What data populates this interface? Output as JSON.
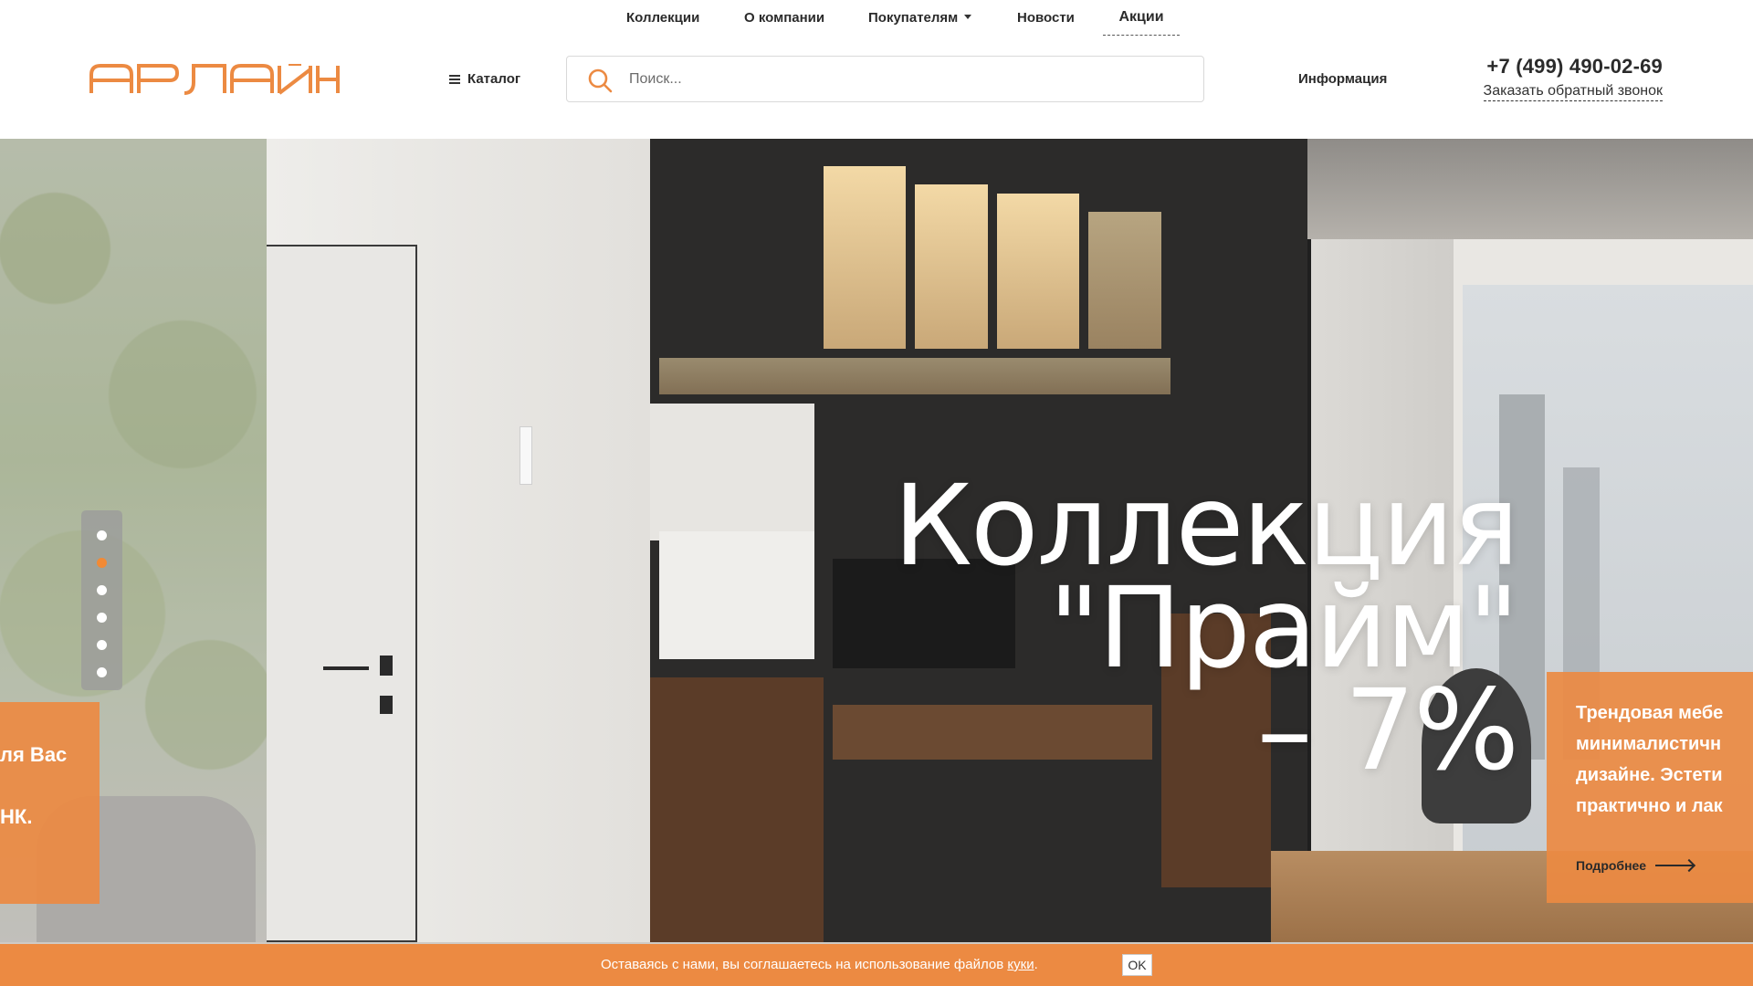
{
  "header": {
    "logo_text": "АРЛАЙН",
    "top_nav": [
      {
        "label": "Коллекции"
      },
      {
        "label": "О компании"
      },
      {
        "label": "Покупателям",
        "has_dropdown": true
      },
      {
        "label": "Новости"
      },
      {
        "label": "Акции",
        "active": true
      }
    ],
    "catalog_label": "Каталог",
    "search_placeholder": "Поиск...",
    "info_label": "Информация",
    "phone": "+7 (499) 490-02-69",
    "callback_label": "Заказать обратный звонок",
    "accent_color": "#ec8a42"
  },
  "hero": {
    "title_lines": [
      "Коллекция",
      "\"Прайм\"",
      "– 7%"
    ],
    "slide_count": 6,
    "active_slide": 2,
    "left_card": {
      "line1": "ля Вас",
      "line2": "НК."
    },
    "right_card": {
      "lines": [
        "Трендовая мебе",
        "минималистичн",
        "дизайне. Эстети",
        "практично и лак"
      ],
      "more_label": "Подробнее"
    }
  },
  "cookie": {
    "text": "Оставаясь с нами, вы соглашаетесь на использование файлов ",
    "link_label": "куки",
    "suffix": ".",
    "ok_label": "OK"
  }
}
